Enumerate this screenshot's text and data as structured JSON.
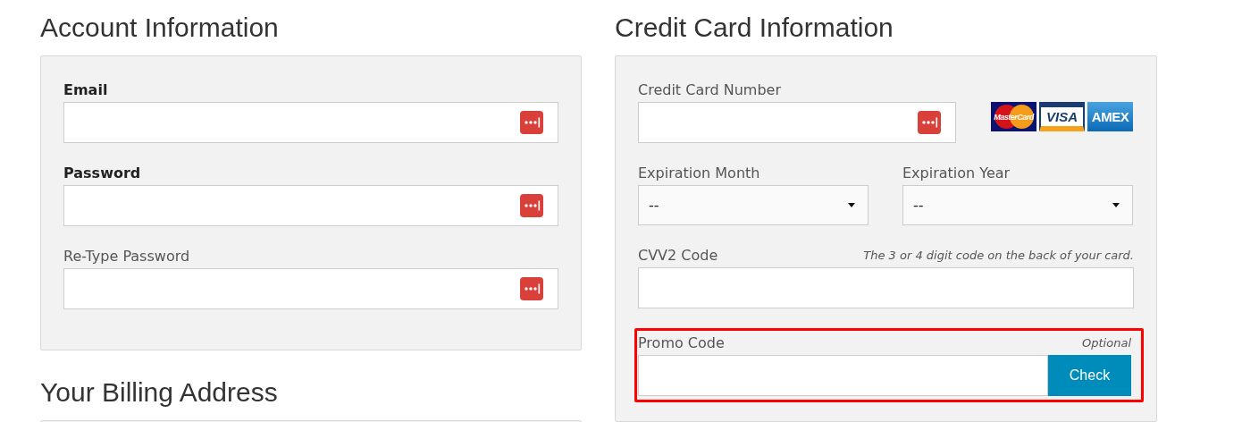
{
  "account": {
    "title": "Account Information",
    "fields": [
      {
        "label": "Email",
        "required": true,
        "manager_icon": true
      },
      {
        "label": "Password",
        "required": true,
        "manager_icon": true
      },
      {
        "label": "Re-Type Password",
        "required": false,
        "manager_icon": true
      }
    ]
  },
  "billing": {
    "title": "Your Billing Address"
  },
  "credit_card": {
    "title": "Credit Card Information",
    "card_number": {
      "label": "Credit Card Number",
      "manager_icon": true
    },
    "card_logos": [
      {
        "kind": "mastercard",
        "label": "MasterCard"
      },
      {
        "kind": "visa",
        "label": "VISA"
      },
      {
        "kind": "amex",
        "label": "AMEX"
      }
    ],
    "expiration": [
      {
        "label": "Expiration Month",
        "value": "--"
      },
      {
        "label": "Expiration Year",
        "value": "--"
      }
    ],
    "cvv": {
      "label": "CVV2 Code",
      "hint": "The 3 or 4 digit code on the back of your card."
    },
    "promo": {
      "label": "Promo Code",
      "note": "Optional",
      "highlighted": true,
      "button": "Check"
    }
  }
}
